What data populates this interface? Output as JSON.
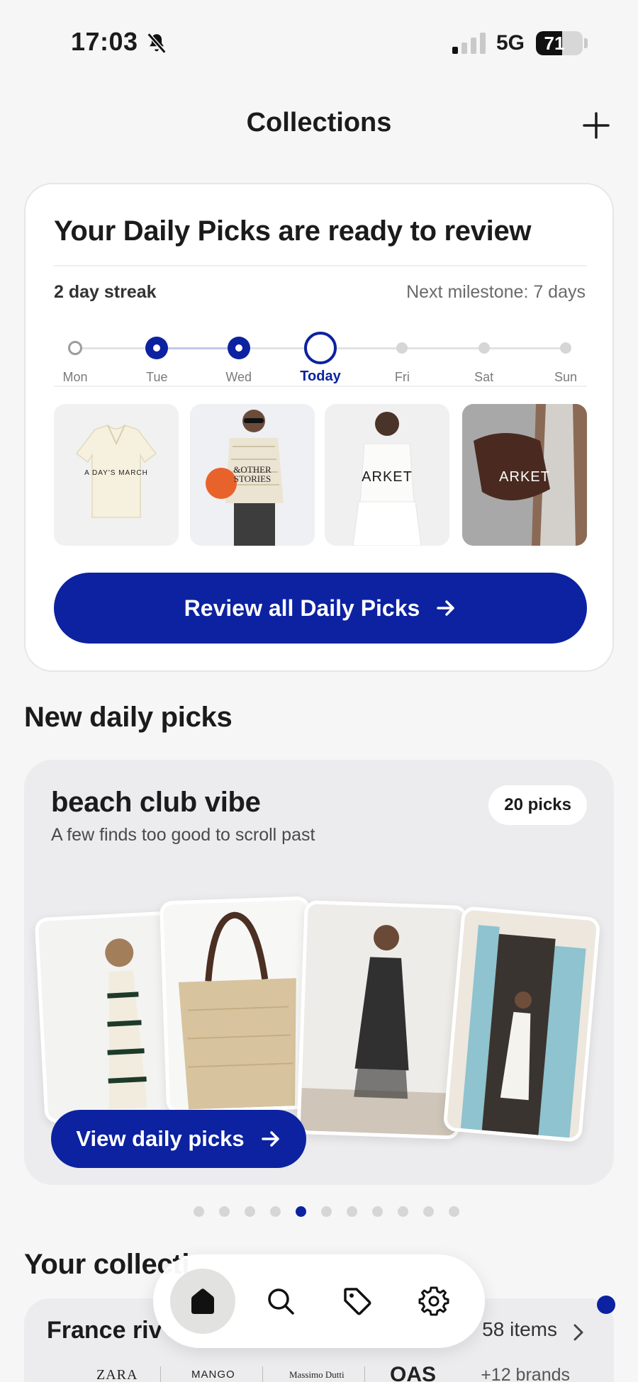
{
  "status": {
    "time": "17:03",
    "network": "5G",
    "battery_level": 71,
    "battery_text": "71",
    "icons": [
      "bell-slash-icon",
      "signal-icon",
      "battery-icon"
    ]
  },
  "header": {
    "title": "Collections",
    "add_icon": "plus-icon"
  },
  "daily_picks": {
    "heading": "Your Daily Picks are ready to review",
    "streak": "2 day streak",
    "milestone": "Next milestone: 7 days",
    "days": [
      {
        "label": "Mon",
        "state": "missed"
      },
      {
        "label": "Tue",
        "state": "done"
      },
      {
        "label": "Wed",
        "state": "done"
      },
      {
        "label": "Today",
        "state": "today"
      },
      {
        "label": "Fri",
        "state": "future"
      },
      {
        "label": "Sat",
        "state": "future"
      },
      {
        "label": "Sun",
        "state": "future"
      }
    ],
    "thumbnails": [
      {
        "brand": "A DAY'S MARCH"
      },
      {
        "brand": "&OTHER STORIES"
      },
      {
        "brand": "ARKET"
      },
      {
        "brand": "ARKET"
      }
    ],
    "review_button": "Review all Daily Picks"
  },
  "new_picks": {
    "section_title": "New daily picks",
    "card": {
      "title": "beach club vibe",
      "subtitle": "A few finds too good to scroll past",
      "count": "20 picks",
      "button": "View daily picks"
    },
    "pager": {
      "total": 11,
      "active_index": 4
    }
  },
  "collections": {
    "section_title": "Your collecti",
    "item": {
      "name": "France riv",
      "count": "58 items",
      "brands": [
        "ZARA",
        "MANGO",
        "Massimo Dutti",
        "OAS"
      ],
      "more_brands": "+12 brands"
    }
  },
  "tabbar": {
    "tabs": [
      {
        "icon": "home-icon",
        "active": true
      },
      {
        "icon": "search-icon",
        "active": false
      },
      {
        "icon": "tag-icon",
        "active": false
      },
      {
        "icon": "gear-icon",
        "active": false
      }
    ]
  },
  "colors": {
    "accent": "#0c22a0",
    "background": "#f6f6f6",
    "card": "#ffffff",
    "muted_card": "#ececee"
  }
}
